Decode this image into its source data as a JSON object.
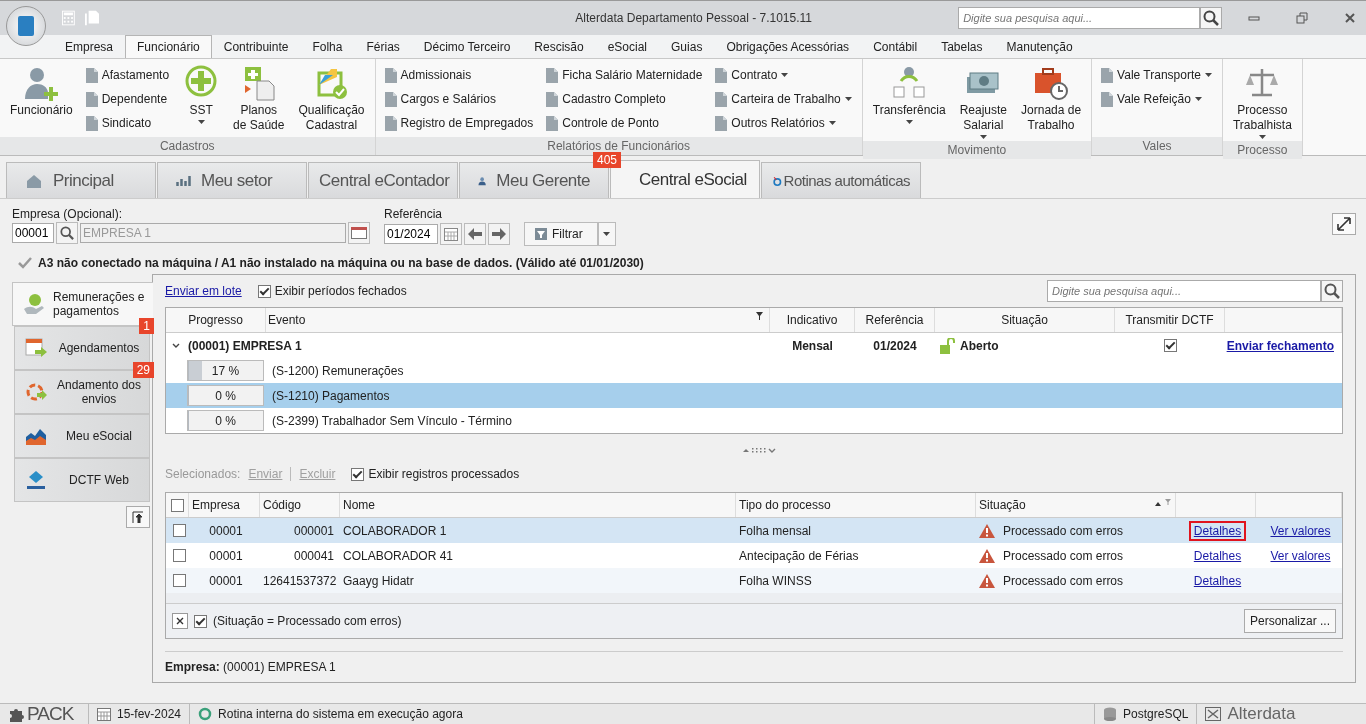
{
  "window": {
    "title": "Alterdata Departamento Pessoal - 7.1015.11",
    "search_placeholder": "Digite sua pesquisa aqui..."
  },
  "menu_tabs": [
    {
      "label": "Empresa",
      "selected": false
    },
    {
      "label": "Funcionário",
      "selected": true
    },
    {
      "label": "Contribuinte",
      "selected": false
    },
    {
      "label": "Folha",
      "selected": false
    },
    {
      "label": "Férias",
      "selected": false
    },
    {
      "label": "Décimo Terceiro",
      "selected": false
    },
    {
      "label": "Rescisão",
      "selected": false
    },
    {
      "label": "eSocial",
      "selected": false
    },
    {
      "label": "Guias",
      "selected": false
    },
    {
      "label": "Obrigações Acessórias",
      "selected": false
    },
    {
      "label": "Contábil",
      "selected": false
    },
    {
      "label": "Tabelas",
      "selected": false
    },
    {
      "label": "Manutenção",
      "selected": false
    }
  ],
  "ribbon": [
    {
      "title": "Cadastros",
      "columns": [
        {
          "kind": "large",
          "label": "Funcionário",
          "dropdown": false
        },
        {
          "kind": "stack",
          "items": [
            {
              "label": "Afastamento",
              "dropdown": false
            },
            {
              "label": "Dependente",
              "dropdown": false
            },
            {
              "label": "Sindicato",
              "dropdown": false
            }
          ]
        },
        {
          "kind": "large",
          "label": "SST",
          "dropdown": true
        },
        {
          "kind": "large",
          "label": "Planos\nde Saúde",
          "dropdown": false
        },
        {
          "kind": "large",
          "label": "Qualificação\nCadastral",
          "dropdown": false
        }
      ]
    },
    {
      "title": "Relatórios de Funcionários",
      "columns": [
        {
          "kind": "stack",
          "items": [
            {
              "label": "Admissionais",
              "dropdown": false
            },
            {
              "label": "Cargos e Salários",
              "dropdown": false
            },
            {
              "label": "Registro de Empregados",
              "dropdown": false
            }
          ]
        },
        {
          "kind": "stack",
          "items": [
            {
              "label": "Ficha Salário Maternidade",
              "dropdown": false
            },
            {
              "label": "Cadastro Completo",
              "dropdown": false
            },
            {
              "label": "Controle de Ponto",
              "dropdown": false
            }
          ]
        },
        {
          "kind": "stack",
          "items": [
            {
              "label": "Contrato",
              "dropdown": true
            },
            {
              "label": "Carteira de Trabalho",
              "dropdown": true
            },
            {
              "label": "Outros Relatórios",
              "dropdown": true
            }
          ]
        }
      ]
    },
    {
      "title": "Movimento",
      "columns": [
        {
          "kind": "large",
          "label": "Transferência",
          "dropdown": true
        },
        {
          "kind": "large",
          "label": "Reajuste\nSalarial",
          "dropdown": true
        },
        {
          "kind": "large",
          "label": "Jornada de\nTrabalho",
          "dropdown": false
        }
      ]
    },
    {
      "title": "Vales",
      "columns": [
        {
          "kind": "stack",
          "items": [
            {
              "label": "Vale Transporte",
              "dropdown": true
            },
            {
              "label": "Vale Refeição",
              "dropdown": true
            }
          ]
        }
      ]
    },
    {
      "title": "Processo",
      "columns": [
        {
          "kind": "large",
          "label": "Processo\nTrabalhista",
          "dropdown": true
        }
      ]
    }
  ],
  "doc_tabs": [
    {
      "label": "Principal",
      "selected": false
    },
    {
      "label": "Meu setor",
      "selected": false
    },
    {
      "label": "Central eContador",
      "selected": false
    },
    {
      "label": "Meu Gerente",
      "selected": false,
      "badge": "405"
    },
    {
      "label": "Central eSocial",
      "selected": true
    },
    {
      "label": "Rotinas automáticas",
      "selected": false
    }
  ],
  "filter": {
    "empresa_label": "Empresa (Opcional):",
    "empresa_code": "00001",
    "empresa_name": "EMPRESA 1",
    "referencia_label": "Referência",
    "referencia": "01/2024",
    "filter_button": "Filtrar"
  },
  "certificate_notice": "A3 não conectado na máquina / A1 não instalado na máquina ou na base de dados. (Válido até 01/01/2030)",
  "side_tabs": [
    {
      "label": "Remunerações e pagamentos",
      "selected": true
    },
    {
      "label": "Agendamentos",
      "selected": false,
      "badge": "1"
    },
    {
      "label": "Andamento dos envios",
      "selected": false,
      "badge": "29"
    },
    {
      "label": "Meu eSocial",
      "selected": false
    },
    {
      "label": "DCTF Web",
      "selected": false
    }
  ],
  "toolbar": {
    "link": "Enviar em lote",
    "checkbox": {
      "label": "Exibir períodos fechados",
      "checked": true
    },
    "search_placeholder": "Digite sua pesquisa aqui..."
  },
  "periods": {
    "columns": [
      "Progresso",
      "Evento",
      "Indicativo",
      "Referência",
      "Situação",
      "Transmitir DCTF"
    ],
    "group": {
      "label": "(00001) EMPRESA 1",
      "expanded": true,
      "indicativo": "Mensal",
      "referencia": "01/2024",
      "situacao": "Aberto",
      "dctf": true,
      "action": "Enviar fechamento"
    },
    "rows": [
      {
        "progress": "17 %",
        "level": 0.17,
        "evento": "(S-1200) Remunerações",
        "selected": false
      },
      {
        "progress": "0 %",
        "level": 0,
        "evento": "(S-1210) Pagamentos",
        "selected": true
      },
      {
        "progress": "0 %",
        "level": 0,
        "evento": "(S-2399) Trabalhador Sem Vínculo - Término",
        "selected": false
      }
    ]
  },
  "records_toolbar": {
    "label": "Selecionados:",
    "actions": [
      {
        "label": "Enviar",
        "disabled": true
      },
      {
        "label": "Excluir",
        "disabled": true
      }
    ],
    "checkbox": {
      "label": "Exibir registros processados",
      "checked": true
    }
  },
  "records": {
    "columns": [
      "Empresa",
      "Código",
      "Nome",
      "Tipo do processo",
      "Situação"
    ],
    "all_checked": false,
    "rows": [
      {
        "checked": false,
        "selected": true,
        "empresa": "00001",
        "codigo": "000001",
        "nome": "COLABORADOR 1",
        "tipo": "Folha mensal",
        "situacao": "Processado com erros",
        "details": "Detalhes",
        "details_highlighted": true,
        "values": "Ver valores"
      },
      {
        "checked": false,
        "selected": false,
        "empresa": "00001",
        "codigo": "000041",
        "nome": "COLABORADOR 41",
        "tipo": "Antecipação de Férias",
        "situacao": "Processado com erros",
        "details": "Detalhes",
        "details_highlighted": false,
        "values": "Ver valores"
      },
      {
        "checked": false,
        "selected": false,
        "empresa": "00001",
        "codigo": "12641537372",
        "nome": "Gaayg Hidatr",
        "tipo": "Folha WINSS",
        "situacao": "Processado com erros",
        "details": "Detalhes",
        "details_highlighted": false
      }
    ],
    "filter": {
      "enabled": true,
      "text": "(Situação = Processado com erros)",
      "button": "Personalizar ..."
    }
  },
  "footer": "**Empresa:** (00001) EMPRESA 1",
  "status_bar": {
    "product": "PACK",
    "date": "15-fev-2024",
    "message": "Rotina interna do sistema em execução agora",
    "database": "PostgreSQL",
    "brand": "Alterdata"
  }
}
